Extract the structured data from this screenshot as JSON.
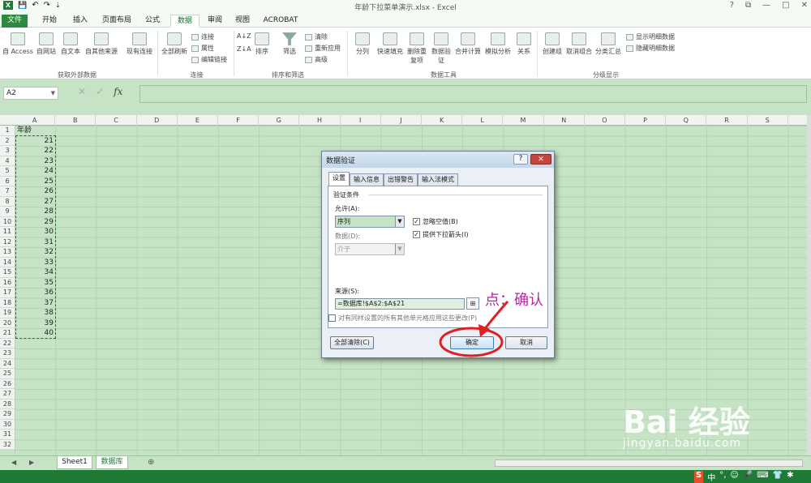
{
  "window": {
    "title": "年龄下拉菜单演示.xlsx - Excel",
    "help": "?",
    "restore": "⧉",
    "minimize": "—",
    "maximize": "□",
    "close": "✕"
  },
  "qat": {
    "save": "💾",
    "undo": "↶",
    "redo": "↷",
    "more": "⇣"
  },
  "tabs": [
    "文件",
    "开始",
    "插入",
    "页面布局",
    "公式",
    "数据",
    "审阅",
    "视图",
    "ACROBAT"
  ],
  "ribbon": {
    "groups": [
      "获取外部数据",
      "连接",
      "排序和筛选",
      "数据工具",
      "分级显示"
    ],
    "external": [
      "自 Access",
      "自网站",
      "自文本",
      "自其他来源",
      "现有连接"
    ],
    "connect": {
      "refresh": "全部刷新",
      "connections": "连接",
      "properties": "属性",
      "edit_links": "编辑链接"
    },
    "sort": {
      "asc": "A↓Z",
      "desc": "Z↓A",
      "sort": "排序",
      "filter": "筛选",
      "clear": "清除",
      "reapply": "重新应用",
      "advanced": "高级"
    },
    "tools": [
      "分列",
      "快速填充",
      "删除重复项",
      "数据验证",
      "合并计算",
      "模拟分析",
      "关系"
    ],
    "outline": {
      "group": "创建组",
      "ungroup": "取消组合",
      "subtotal": "分类汇总",
      "show": "显示明细数据",
      "hide": "隐藏明细数据"
    }
  },
  "formula_bar": {
    "name_box": "A2",
    "cancel": "✕",
    "enter": "✓",
    "fx": "fx"
  },
  "columns": [
    "A",
    "B",
    "C",
    "D",
    "E",
    "F",
    "G",
    "H",
    "I",
    "J",
    "K",
    "L",
    "M",
    "N",
    "O",
    "P",
    "Q",
    "R",
    "S"
  ],
  "rows": [
    "1",
    "2",
    "3",
    "4",
    "5",
    "6",
    "7",
    "8",
    "9",
    "10",
    "11",
    "12",
    "13",
    "14",
    "15",
    "16",
    "17",
    "18",
    "19",
    "20",
    "21",
    "22",
    "23",
    "24",
    "25",
    "26",
    "27",
    "28",
    "29",
    "30",
    "31",
    "32"
  ],
  "cells": {
    "a1": "年龄",
    "ages": [
      "21",
      "22",
      "23",
      "24",
      "25",
      "26",
      "27",
      "28",
      "29",
      "30",
      "31",
      "32",
      "33",
      "34",
      "35",
      "36",
      "37",
      "38",
      "39",
      "40"
    ]
  },
  "sheets": [
    "Sheet1",
    "数据库"
  ],
  "sheet_add": "⊕",
  "dialog": {
    "title": "数据验证",
    "help": "?",
    "close": "✕",
    "tabs": [
      "设置",
      "输入信息",
      "出错警告",
      "输入法模式"
    ],
    "section": "验证条件",
    "allow_label": "允许(A):",
    "allow_value": "序列",
    "ignore_blank": "忽略空值(B)",
    "dropdown": "提供下拉箭头(I)",
    "data_label": "数据(D):",
    "data_value": "介于",
    "source_label": "来源(S):",
    "source_value": "=数据库!$A$2:$A$21",
    "apply_all": "对有同样设置的所有其他单元格应用这些更改(P)",
    "clear_all": "全部清除(C)",
    "ok": "确定",
    "cancel": "取消"
  },
  "annotation": "点：确认",
  "watermark": {
    "logo": "Bai 经验",
    "url": "jingyan.baidu.com"
  },
  "colors": {
    "accent": "#1f7a36",
    "annotation": "#b02a9e",
    "ok_circle": "#e02020"
  }
}
